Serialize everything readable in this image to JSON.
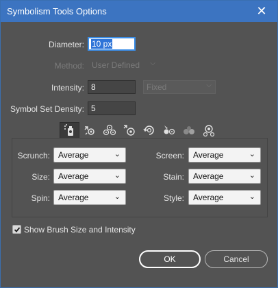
{
  "window": {
    "title": "Symbolism Tools Options",
    "close_glyph": "✕"
  },
  "fields": {
    "diameter": {
      "label": "Diameter:",
      "value": "10 px"
    },
    "method": {
      "label": "Method:",
      "value": "User Defined"
    },
    "intensity": {
      "label": "Intensity:",
      "value": "8",
      "mode": "Fixed"
    },
    "density": {
      "label": "Symbol Set Density:",
      "value": "5"
    }
  },
  "tools": [
    {
      "name": "symbol-sprayer-icon",
      "selected": true
    },
    {
      "name": "symbol-shifter-icon",
      "selected": false
    },
    {
      "name": "symbol-scruncher-icon",
      "selected": false
    },
    {
      "name": "symbol-sizer-icon",
      "selected": false
    },
    {
      "name": "symbol-spinner-icon",
      "selected": false
    },
    {
      "name": "symbol-stainer-icon",
      "selected": false
    },
    {
      "name": "symbol-screener-icon",
      "selected": false
    },
    {
      "name": "symbol-styler-icon",
      "selected": false
    }
  ],
  "options": {
    "scrunch": {
      "label": "Scrunch:",
      "value": "Average"
    },
    "size": {
      "label": "Size:",
      "value": "Average"
    },
    "spin": {
      "label": "Spin:",
      "value": "Average"
    },
    "screen": {
      "label": "Screen:",
      "value": "Average"
    },
    "stain": {
      "label": "Stain:",
      "value": "Average"
    },
    "style": {
      "label": "Style:",
      "value": "Average"
    }
  },
  "show_brush": {
    "label": "Show Brush Size and Intensity",
    "checked": true
  },
  "buttons": {
    "ok": "OK",
    "cancel": "Cancel"
  },
  "colors": {
    "titlebar": "#3c74c1",
    "dialog_bg": "#535353",
    "focus": "#3b8ee8"
  }
}
